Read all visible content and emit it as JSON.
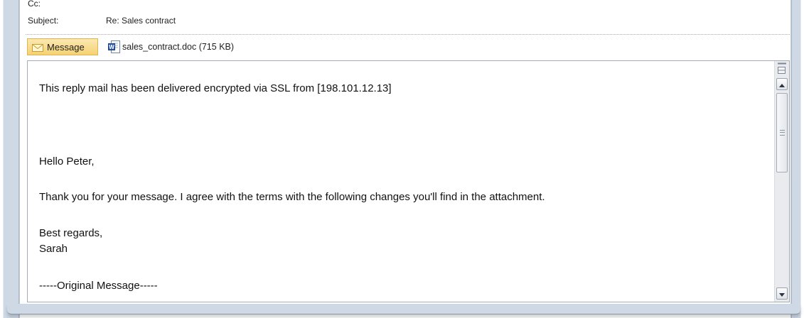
{
  "header": {
    "cc_label": "Cc:",
    "subject_label": "Subject:",
    "subject_value": "Re: Sales contract"
  },
  "tabs": {
    "message_label": "Message"
  },
  "attachment": {
    "label": "sales_contract.doc (715 KB)"
  },
  "body": {
    "line1": "This reply mail has been delivered encrypted via SSL from  [198.101.12.13]",
    "greeting": "Hello Peter,",
    "message": "Thank you for your message. I agree with the terms with the following changes you'll find in the attachment.",
    "closing": "Best regards,",
    "signature": "Sarah",
    "original_header": "-----Original Message-----"
  },
  "icons": {
    "message_tab": "envelope-icon",
    "attachment": "word-document-icon",
    "scroll_up": "arrow-up-icon",
    "scroll_down": "arrow-down-icon",
    "split": "split-view-icon"
  },
  "colors": {
    "frame": "#cfd9e6",
    "tab_highlight": "#f5d373",
    "border": "#a5acb5"
  }
}
